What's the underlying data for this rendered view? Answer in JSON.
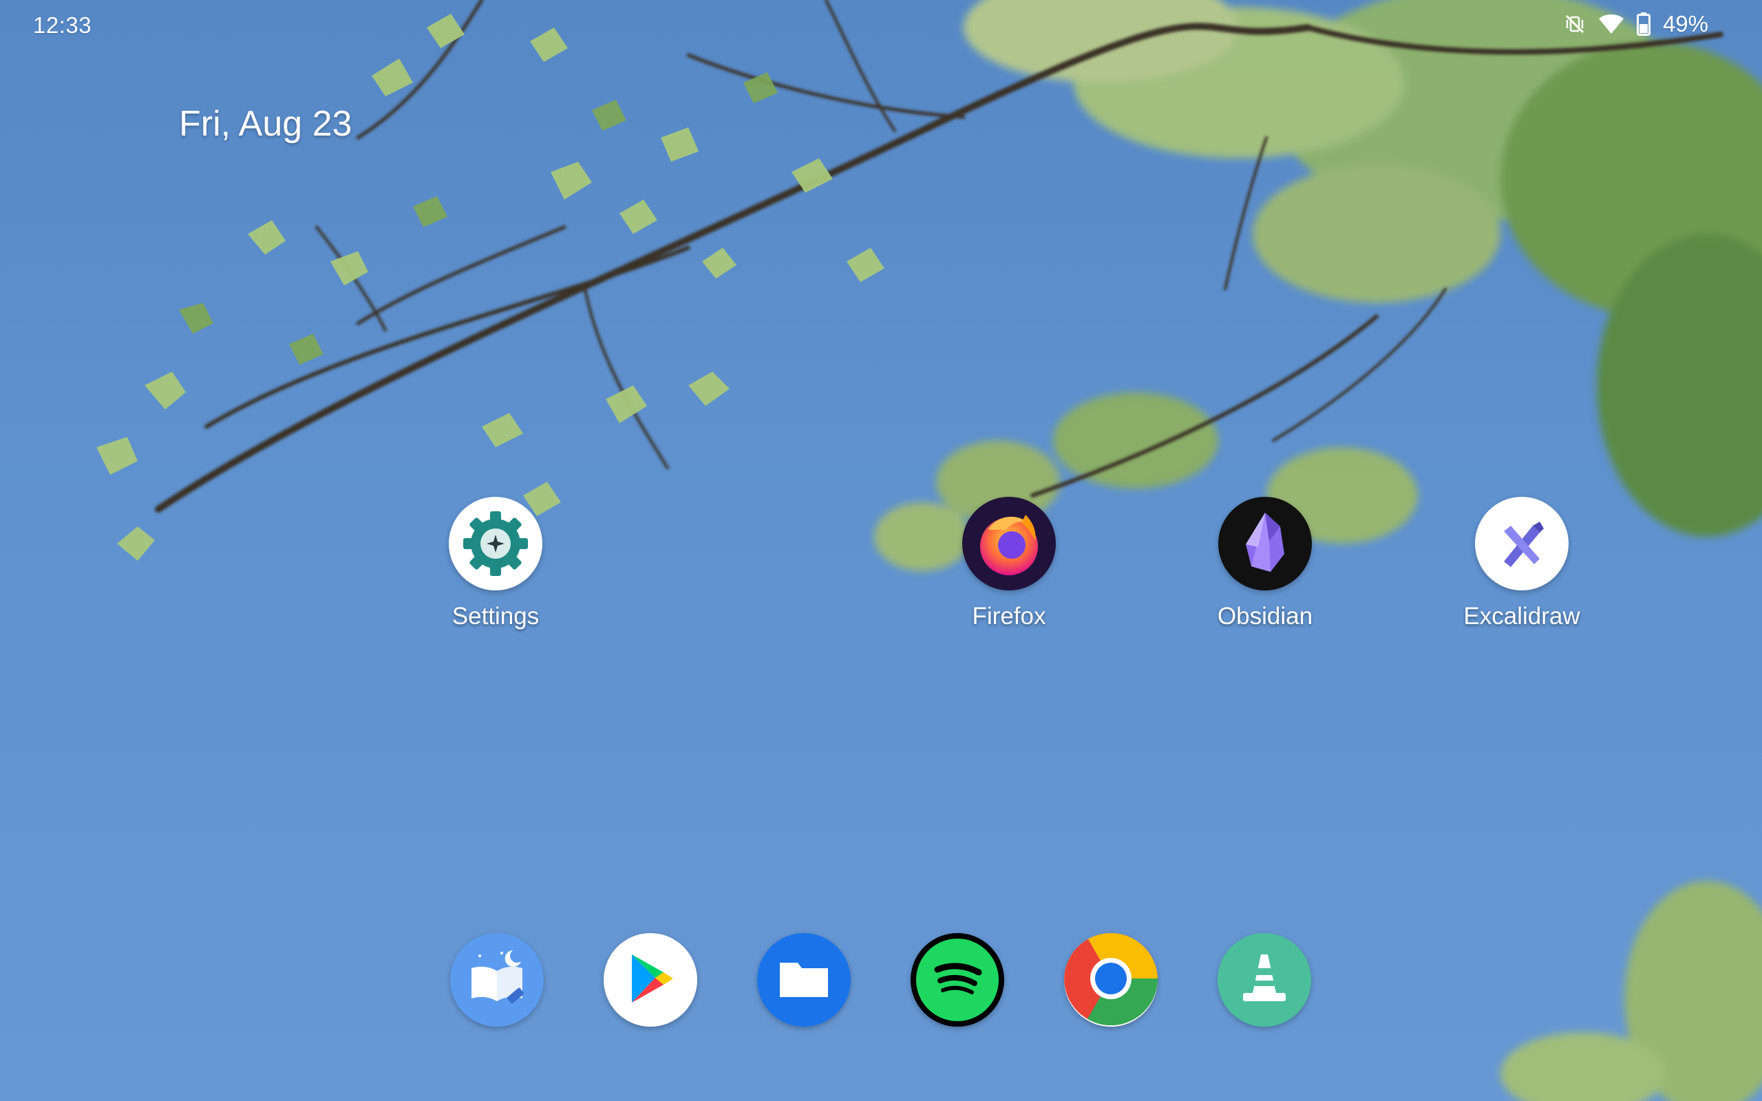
{
  "status_bar": {
    "time": "12:33",
    "battery_percent": "49%",
    "icons": [
      "vibrate-off-icon",
      "wifi-icon",
      "battery-icon"
    ]
  },
  "date_widget": {
    "text": "Fri, Aug 23"
  },
  "home_apps": [
    {
      "label": "Settings",
      "icon": "settings-gear-icon"
    },
    {
      "label": "Firefox",
      "icon": "firefox-icon"
    },
    {
      "label": "Obsidian",
      "icon": "obsidian-icon"
    },
    {
      "label": "Excalidraw",
      "icon": "excalidraw-icon"
    }
  ],
  "dock_apps": [
    {
      "icon": "ebook-reader-icon"
    },
    {
      "icon": "play-store-icon"
    },
    {
      "icon": "files-icon"
    },
    {
      "icon": "spotify-icon"
    },
    {
      "icon": "chrome-icon"
    },
    {
      "icon": "vlc-icon"
    }
  ],
  "colors": {
    "sky": "#5f92cf",
    "leaf": "#8fbf5a",
    "branch": "#3b3326"
  }
}
